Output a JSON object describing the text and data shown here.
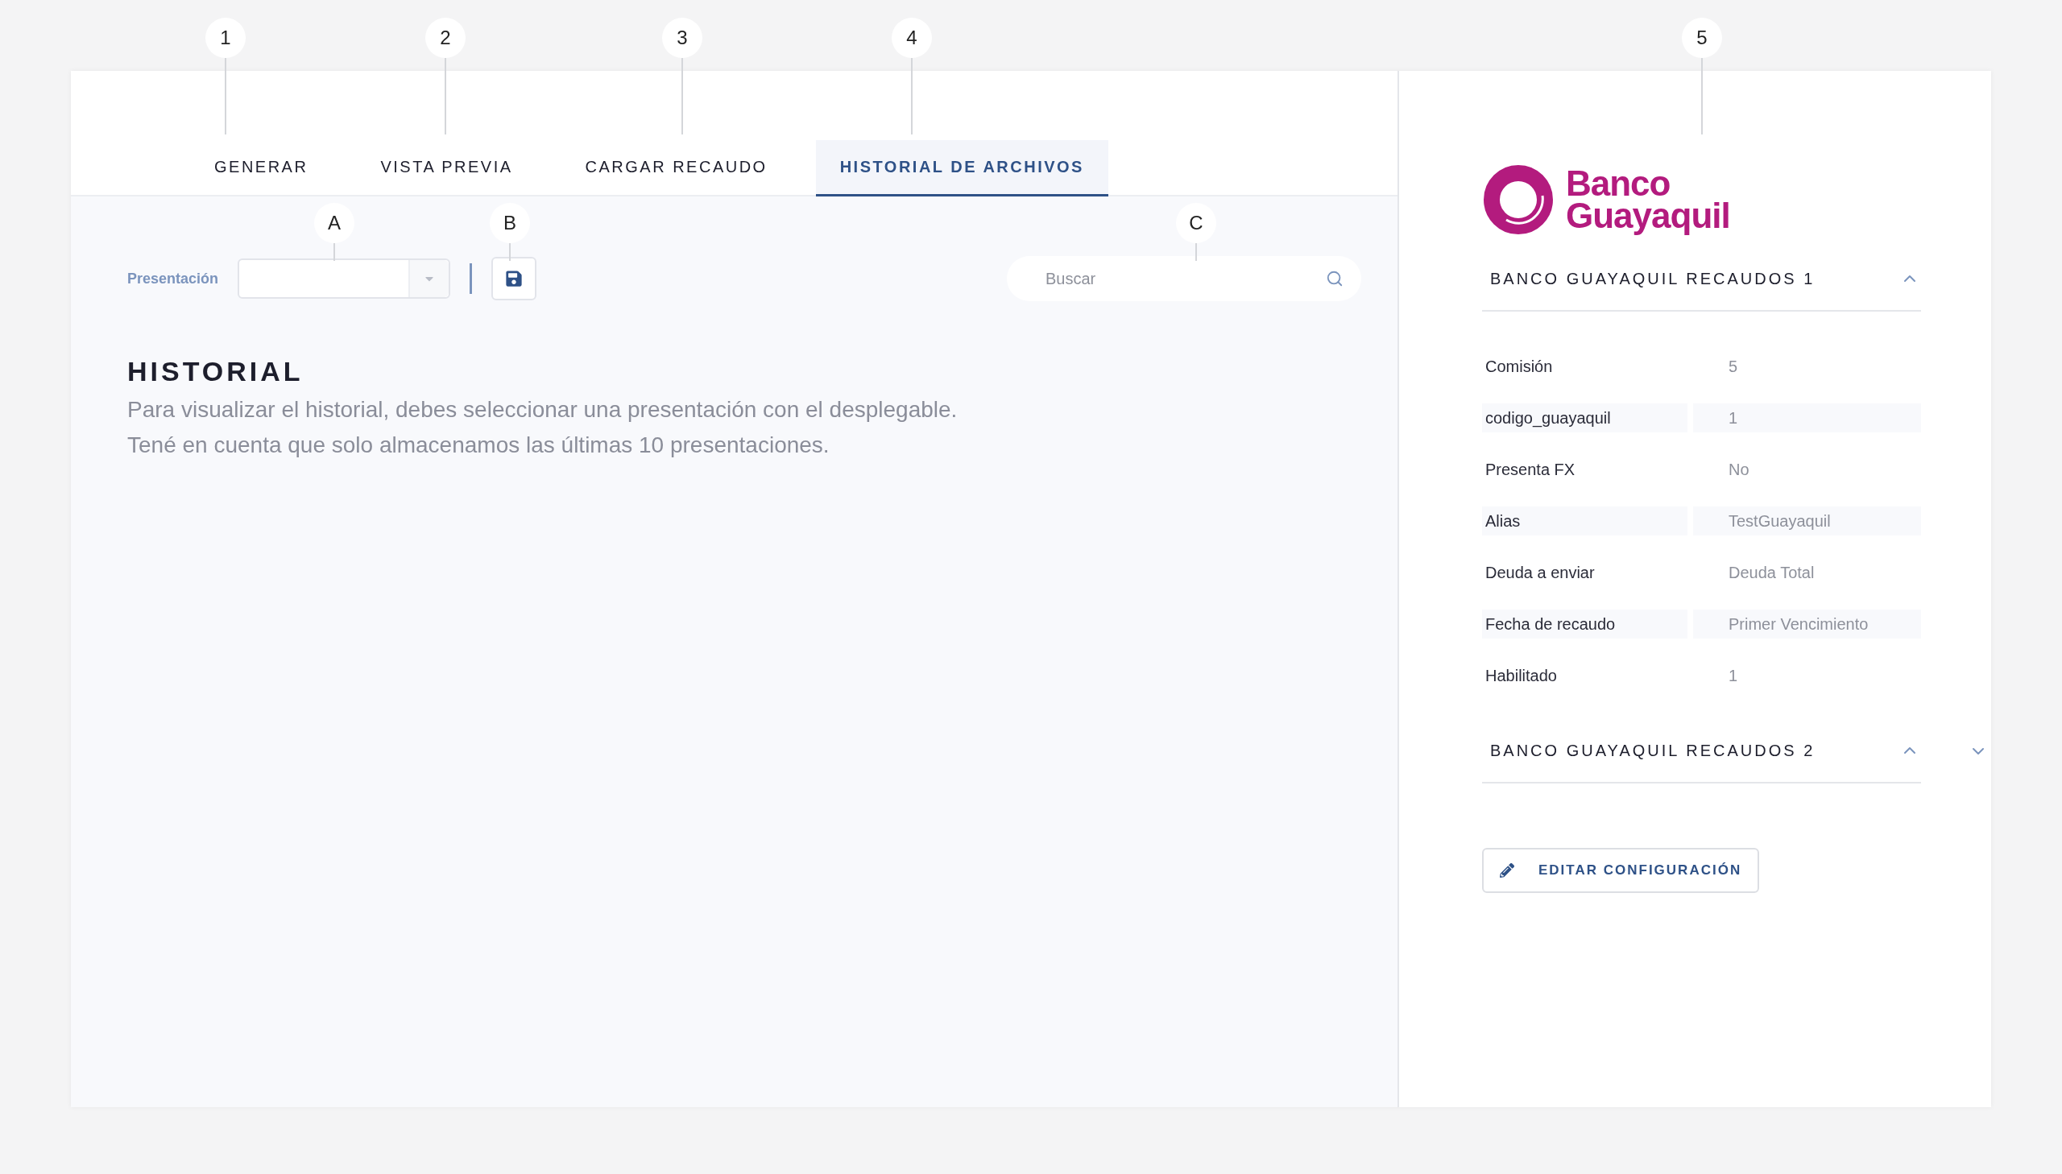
{
  "callouts": [
    {
      "label": "1"
    },
    {
      "label": "2"
    },
    {
      "label": "3"
    },
    {
      "label": "4"
    },
    {
      "label": "5"
    },
    {
      "label": "A"
    },
    {
      "label": "B"
    },
    {
      "label": "C"
    }
  ],
  "tabs": [
    {
      "label": "GENERAR",
      "selected": false
    },
    {
      "label": "VISTA PREVIA",
      "selected": false
    },
    {
      "label": "CARGAR RECAUDO",
      "selected": false
    },
    {
      "label": "HISTORIAL DE ARCHIVOS",
      "selected": true
    }
  ],
  "toolbar": {
    "label": "Presentación",
    "search": {
      "placeholder": "Buscar"
    }
  },
  "history": {
    "title": "HISTORIAL",
    "lines": [
      "Para visualizar el historial, debes seleccionar una presentación con el desplegable.",
      "Tené en cuenta que solo almacenamos las últimas 10 presentaciones."
    ]
  },
  "logo": {
    "line1": "Banco",
    "line2": "Guayaquil"
  },
  "sections": [
    {
      "title": "BANCO GUAYAQUIL RECAUDOS 1",
      "rows": [
        {
          "label": "Comisión",
          "value": "5"
        },
        {
          "label": "codigo_guayaquil",
          "value": "1"
        },
        {
          "label": "Presenta FX",
          "value": "No"
        },
        {
          "label": "Alias",
          "value": "TestGuayaquil"
        },
        {
          "label": "Deuda a enviar",
          "value": "Deuda Total"
        },
        {
          "label": "Fecha de recaudo",
          "value": "Primer Vencimiento"
        },
        {
          "label": "Habilitado",
          "value": "1"
        }
      ]
    },
    {
      "title": "BANCO GUAYAQUIL RECAUDOS 2"
    }
  ],
  "edit_button": "EDITAR CONFIGURACIÓN"
}
